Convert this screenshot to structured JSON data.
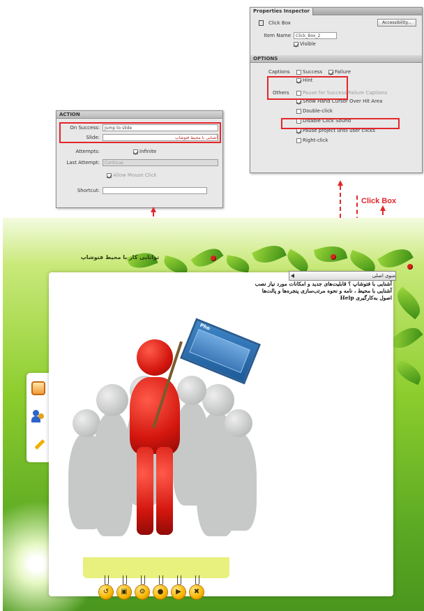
{
  "top_right_panel": {
    "tabs": [
      "Properties Inspector",
      "",
      "",
      ""
    ],
    "object_label": "Click Box",
    "accessibility_button": "Accessibility...",
    "item_name_label": "Item Name",
    "item_name_value": "Click_Box_2",
    "visible_label": "Visible",
    "section_title": "OPTIONS",
    "captions_label": "Captions",
    "captions_success": "Success",
    "captions_failure": "Failure",
    "captions_hint": "Hint",
    "others_label": "Others",
    "others_items": [
      "Pause for Success/Failure Captions",
      "Show Hand Cursor Over Hit Area",
      "Double-click",
      "Disable Click Sound",
      "Pause project until user clicks",
      "Right-click"
    ]
  },
  "left_panel": {
    "section_title": "ACTION",
    "on_success_label": "On Success:",
    "on_success_value": "Jump to slide",
    "slide_label": "Slide:",
    "slide_value": "آشنایی با محیط فتوشاپ",
    "attempts_label": "Attempts:",
    "infinite_label": "Infinite",
    "last_attempt_label": "Last Attempt:",
    "last_attempt_value": "Continue",
    "allow_mouse_label": "Allow Mouse Click",
    "shortcut_label": "Shortcut:",
    "shortcut_value": ""
  },
  "annotation": {
    "click_box_label": "Click Box"
  },
  "app": {
    "title": "توانایی کار با محیط فتوشاپ",
    "menu_bar_label": "منوی اصلی",
    "menu_lines": [
      "آشنایی با فتوشاپ ؟ قابلیت‌های جدید و امکانات مورد نیاز نصب",
      "آشنایی با محیط ، نامه و نحوه مرتب‌سازی پنجره‌ها و پالت‌ها",
      "اصول به‌کارگیری Help"
    ],
    "sign_text": "Pho",
    "bottom_buttons": [
      "undo",
      "folder",
      "settings",
      "help",
      "next",
      "close"
    ]
  },
  "colors": {
    "highlight": "#e2262a",
    "green_dark": "#4a961e",
    "green_light": "#c9e97a",
    "button_gold": "#f7b500"
  }
}
